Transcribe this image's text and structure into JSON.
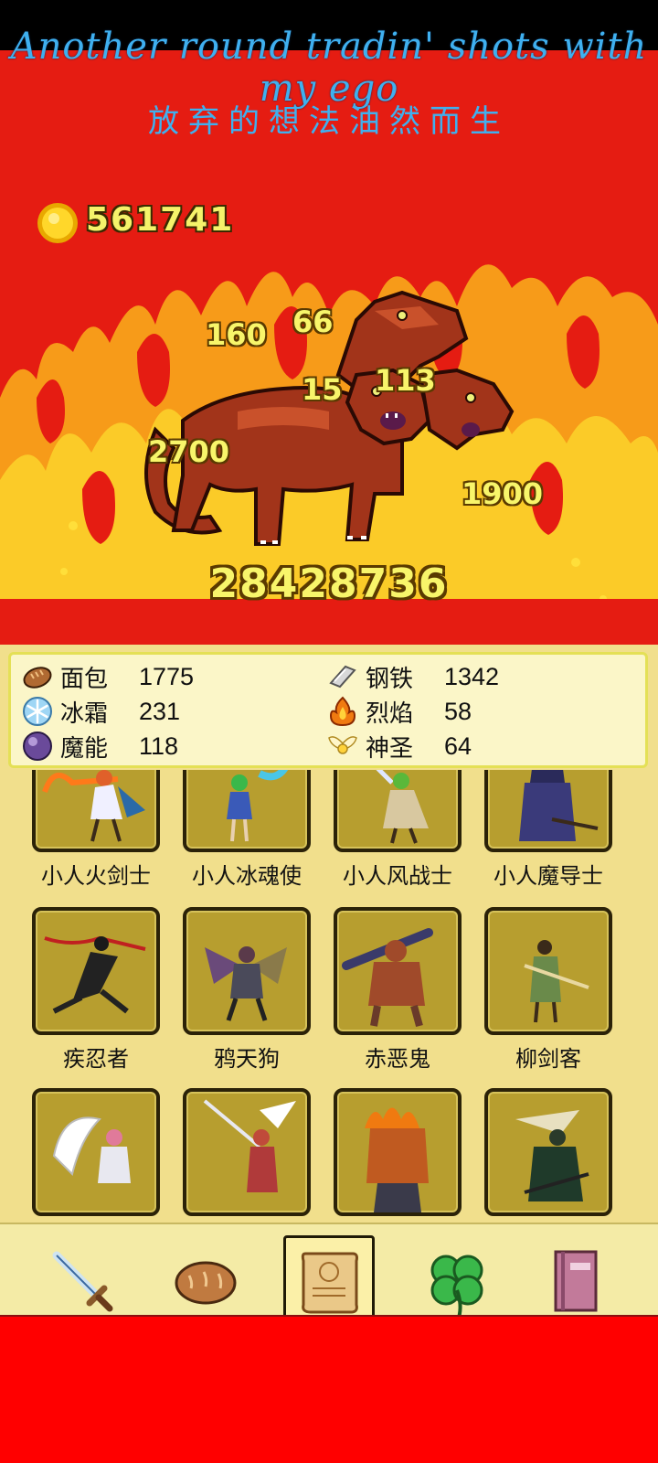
{
  "lyrics": {
    "line1": "Another round tradin' shots with my ego",
    "line2": "放弃的想法油然而生"
  },
  "hud": {
    "gold": "561741",
    "coin_icon": "gold-coin-icon"
  },
  "battle": {
    "boss_hp": "28428736",
    "damage_numbers": [
      "160",
      "66",
      "15",
      "113",
      "2700",
      "1900"
    ],
    "monster": "three-headed-hellhound"
  },
  "resources": [
    {
      "name": "面包",
      "value": "1775",
      "icon": "bread-icon"
    },
    {
      "name": "钢铁",
      "value": "1342",
      "icon": "steel-ingot-icon"
    },
    {
      "name": "冰霜",
      "value": "231",
      "icon": "snowflake-icon"
    },
    {
      "name": "烈焰",
      "value": "58",
      "icon": "flame-icon"
    },
    {
      "name": "魔能",
      "value": "118",
      "icon": "magic-orb-icon"
    },
    {
      "name": "神圣",
      "value": "64",
      "icon": "holy-wings-icon"
    }
  ],
  "heroes": [
    {
      "name": "小人火剑士"
    },
    {
      "name": "小人冰魂使"
    },
    {
      "name": "小人风战士"
    },
    {
      "name": "小人魔导士"
    },
    {
      "name": "疾忍者"
    },
    {
      "name": "鸦天狗"
    },
    {
      "name": "赤恶鬼"
    },
    {
      "name": "柳剑客"
    },
    {
      "name": ""
    },
    {
      "name": ""
    },
    {
      "name": ""
    },
    {
      "name": ""
    }
  ],
  "nav": {
    "items": [
      "sword-icon",
      "bread-icon",
      "scroll-icon",
      "clover-icon",
      "book-icon"
    ],
    "selected": "scroll-icon"
  },
  "colors": {
    "background_red": "#e51c12",
    "gold_text": "#f5f36a",
    "lyric_blue": "#3fb0ef",
    "panel": "#f1df8c"
  }
}
